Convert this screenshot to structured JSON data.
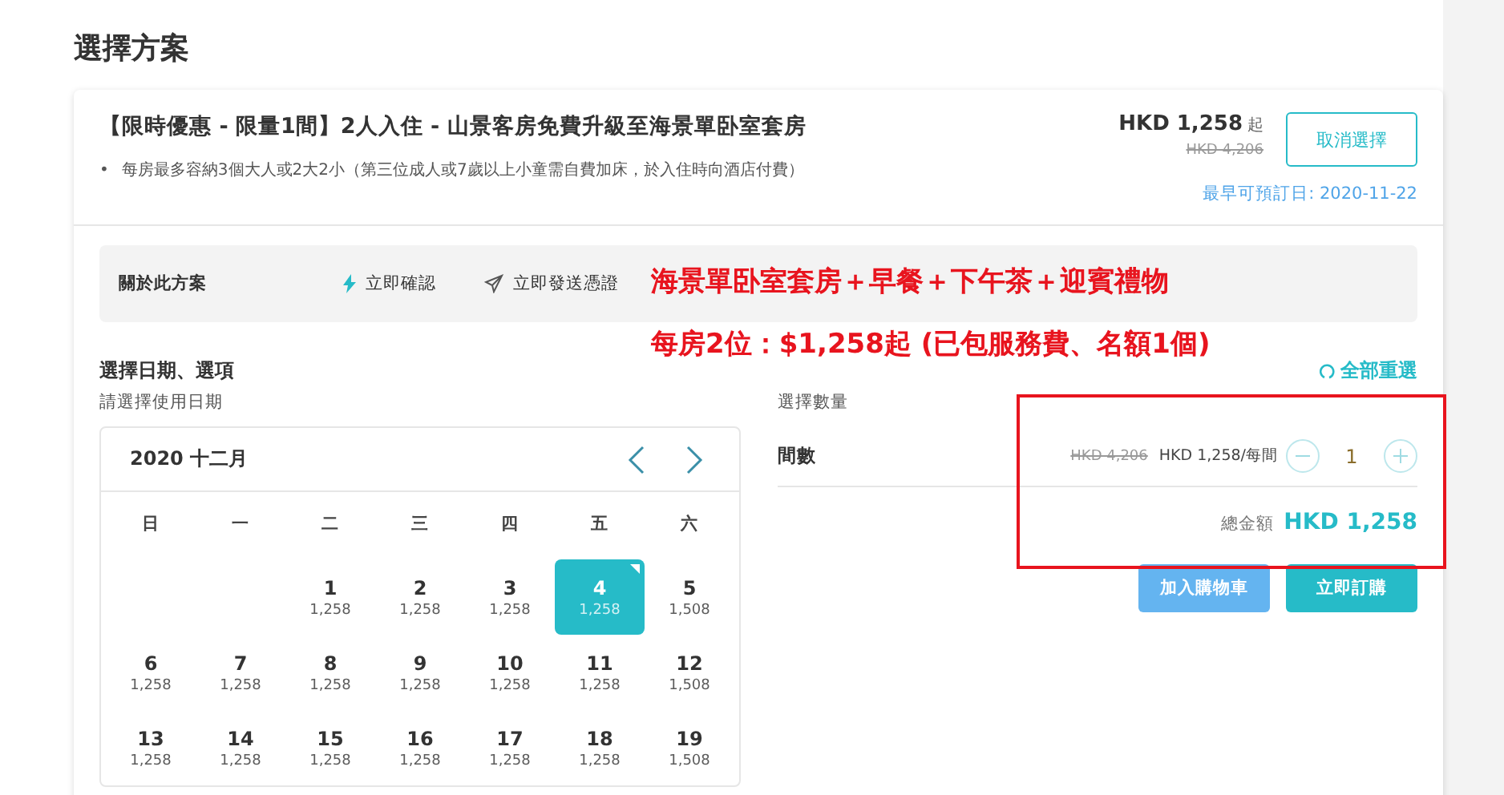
{
  "page_title": "選擇方案",
  "package": {
    "title": "【限時優惠 - 限量1間】2人入住 - 山景客房免費升級至海景單卧室套房",
    "note_marker": "•",
    "notes": [
      "每房最多容納3個大人或2大2小（第三位成人或7歲以上小童需自費加床，於入住時向酒店付費）"
    ],
    "price": "HKD 1,258",
    "price_suffix": "起",
    "original_price": "HKD 4,206",
    "cancel_button": "取消選擇",
    "earliest_date": "最早可預訂日: 2020-11-22"
  },
  "info_bar": {
    "label": "關於此方案",
    "features": [
      {
        "kind": "bolt",
        "text": "立即確認"
      },
      {
        "kind": "send",
        "text": "立即發送憑證"
      }
    ]
  },
  "annotation": {
    "lines": [
      "海景單卧室套房＋早餐＋下午茶＋迎賓禮物",
      "每房2位：$1,258起 (已包服務費、名額1個)"
    ]
  },
  "section_title": "選擇日期、選項",
  "reset_link": "全部重選",
  "calendar": {
    "label": "請選擇使用日期",
    "month": "2020 十二月",
    "weekdays": [
      "日",
      "一",
      "二",
      "三",
      "四",
      "五",
      "六"
    ],
    "weeks": [
      [
        {
          "kind": "empty"
        },
        {
          "kind": "empty"
        },
        {
          "kind": "day",
          "day": "1",
          "price": "1,258",
          "selected": false
        },
        {
          "kind": "day",
          "day": "2",
          "price": "1,258",
          "selected": false
        },
        {
          "kind": "day",
          "day": "3",
          "price": "1,258",
          "selected": false
        },
        {
          "kind": "day",
          "day": "4",
          "price": "1,258",
          "selected": true
        },
        {
          "kind": "day",
          "day": "5",
          "price": "1,508",
          "selected": false
        }
      ],
      [
        {
          "kind": "day",
          "day": "6",
          "price": "1,258",
          "selected": false
        },
        {
          "kind": "day",
          "day": "7",
          "price": "1,258",
          "selected": false
        },
        {
          "kind": "day",
          "day": "8",
          "price": "1,258",
          "selected": false
        },
        {
          "kind": "day",
          "day": "9",
          "price": "1,258",
          "selected": false
        },
        {
          "kind": "day",
          "day": "10",
          "price": "1,258",
          "selected": false
        },
        {
          "kind": "day",
          "day": "11",
          "price": "1,258",
          "selected": false
        },
        {
          "kind": "day",
          "day": "12",
          "price": "1,508",
          "selected": false
        }
      ],
      [
        {
          "kind": "day",
          "day": "13",
          "price": "1,258",
          "selected": false
        },
        {
          "kind": "day",
          "day": "14",
          "price": "1,258",
          "selected": false
        },
        {
          "kind": "day",
          "day": "15",
          "price": "1,258",
          "selected": false
        },
        {
          "kind": "day",
          "day": "16",
          "price": "1,258",
          "selected": false
        },
        {
          "kind": "day",
          "day": "17",
          "price": "1,258",
          "selected": false
        },
        {
          "kind": "day",
          "day": "18",
          "price": "1,258",
          "selected": false
        },
        {
          "kind": "day",
          "day": "19",
          "price": "1,508",
          "selected": false
        }
      ]
    ]
  },
  "quantity": {
    "label": "選擇數量",
    "item_label": "間數",
    "original_price": "HKD 4,206",
    "price": "HKD 1,258/每間",
    "value": "1",
    "total_label": "總金額",
    "total": "HKD 1,258"
  },
  "buttons": [
    {
      "kind": "cart",
      "label": "加入購物車"
    },
    {
      "kind": "buy",
      "label": "立即訂購"
    }
  ]
}
